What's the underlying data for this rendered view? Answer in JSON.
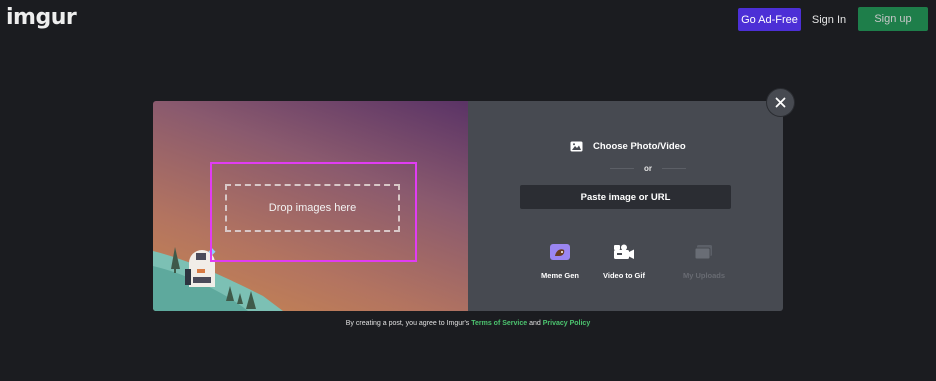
{
  "header": {
    "logo": "imgur",
    "go_ad_free": "Go Ad-Free",
    "sign_in": "Sign In",
    "sign_up": "Sign up"
  },
  "upload": {
    "drop_label": "Drop images here",
    "choose_label": "Choose Photo/Video",
    "or_label": "or",
    "paste_label": "Paste image or URL",
    "tools": [
      {
        "label": "Meme Gen",
        "icon": "meme-gen-icon",
        "enabled": true
      },
      {
        "label": "Video to Gif",
        "icon": "video-camera-icon",
        "enabled": true
      },
      {
        "label": "My Uploads",
        "icon": "images-stack-icon",
        "enabled": false
      }
    ]
  },
  "footer": {
    "prefix": "By creating a post, you agree to Imgur's",
    "terms": "Terms of Service",
    "and": "and",
    "privacy": "Privacy Policy"
  },
  "colors": {
    "background": "#1b1c20",
    "accent_purple": "#4c2fd6",
    "accent_green": "#1f9f58",
    "link_green": "#4cc46f",
    "drop_highlight": "#e13cf3"
  }
}
